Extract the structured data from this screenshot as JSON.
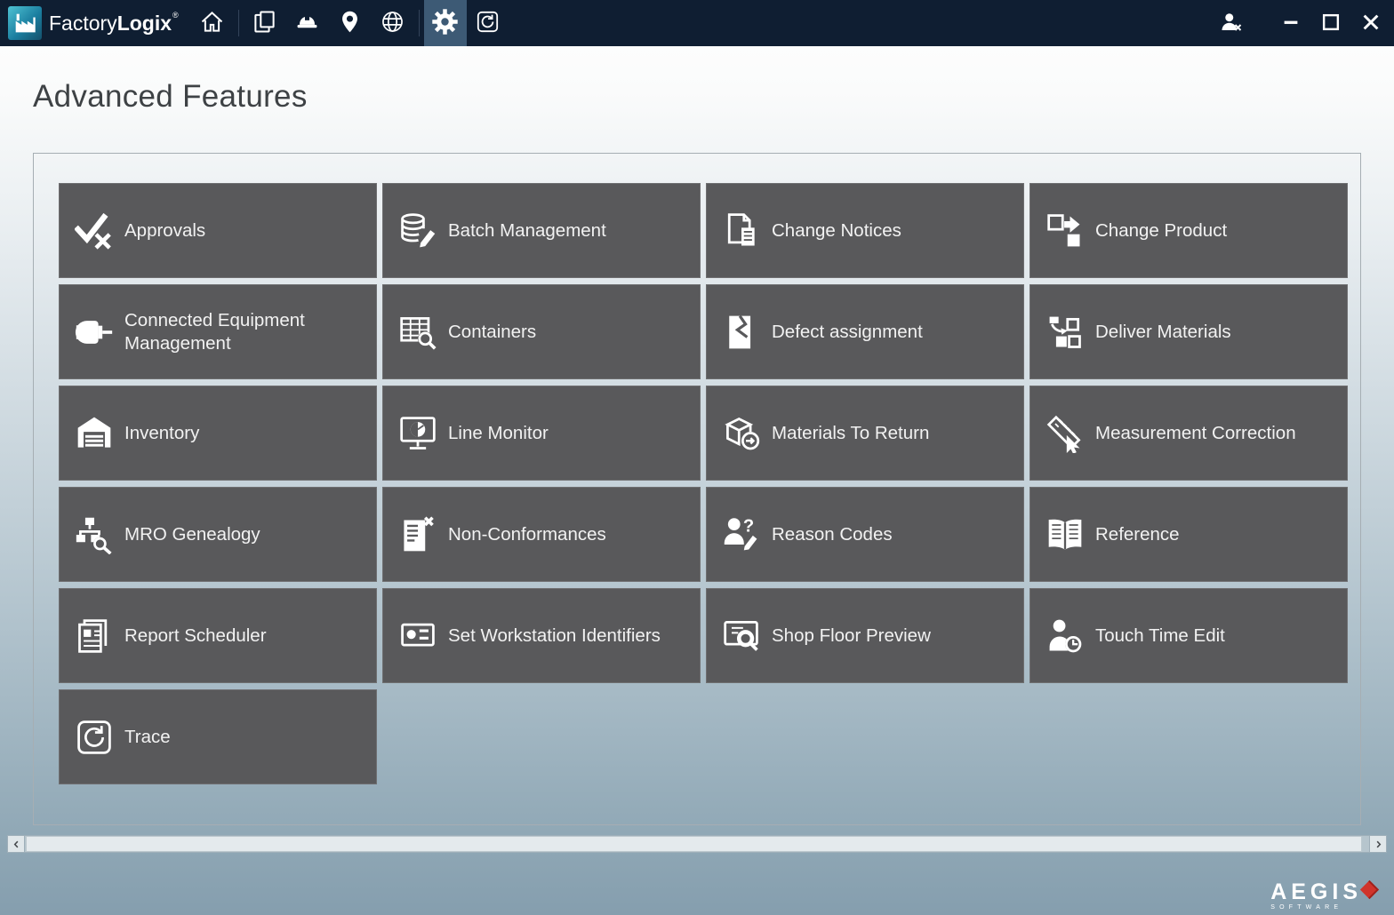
{
  "titlebar": {
    "brand_light": "Factory",
    "brand_bold": "Logix",
    "brand_mark": "®",
    "icons": [
      "home-icon",
      "documents-icon",
      "production-icon",
      "locations-icon",
      "web-icon",
      "settings-icon",
      "trace-icon"
    ],
    "selected_tool": "settings",
    "window_controls": [
      "logout-user-icon",
      "minimize-icon",
      "maximize-icon",
      "close-icon"
    ]
  },
  "page": {
    "title": "Advanced Features"
  },
  "tiles": [
    {
      "label": "Approvals",
      "icon": "approvals-icon"
    },
    {
      "label": "Batch Management",
      "icon": "batch-management-icon"
    },
    {
      "label": "Change Notices",
      "icon": "change-notices-icon"
    },
    {
      "label": "Change Product",
      "icon": "change-product-icon"
    },
    {
      "label": "Connected Equipment Management",
      "icon": "connected-equipment-icon"
    },
    {
      "label": "Containers",
      "icon": "containers-icon"
    },
    {
      "label": "Defect assignment",
      "icon": "defect-assignment-icon"
    },
    {
      "label": "Deliver Materials",
      "icon": "deliver-materials-icon"
    },
    {
      "label": "Inventory",
      "icon": "inventory-icon"
    },
    {
      "label": "Line Monitor",
      "icon": "line-monitor-icon"
    },
    {
      "label": "Materials To Return",
      "icon": "materials-to-return-icon"
    },
    {
      "label": "Measurement Correction",
      "icon": "measurement-correction-icon"
    },
    {
      "label": "MRO Genealogy",
      "icon": "mro-genealogy-icon"
    },
    {
      "label": "Non-Conformances",
      "icon": "non-conformances-icon"
    },
    {
      "label": "Reason Codes",
      "icon": "reason-codes-icon"
    },
    {
      "label": "Reference",
      "icon": "reference-icon"
    },
    {
      "label": "Report Scheduler",
      "icon": "report-scheduler-icon"
    },
    {
      "label": "Set Workstation Identifiers",
      "icon": "set-workstation-identifiers-icon"
    },
    {
      "label": "Shop Floor Preview",
      "icon": "shop-floor-preview-icon"
    },
    {
      "label": "Touch Time Edit",
      "icon": "touch-time-edit-icon"
    },
    {
      "label": "Trace",
      "icon": "trace-icon"
    }
  ],
  "footer": {
    "brand": "AEGIS",
    "software": "SOFTWARE"
  },
  "colors": {
    "titlebar": "#0f1e32",
    "selected_tool_bg": "#3d5a75",
    "tile": "#59595b",
    "accent_red": "#d0342c"
  }
}
